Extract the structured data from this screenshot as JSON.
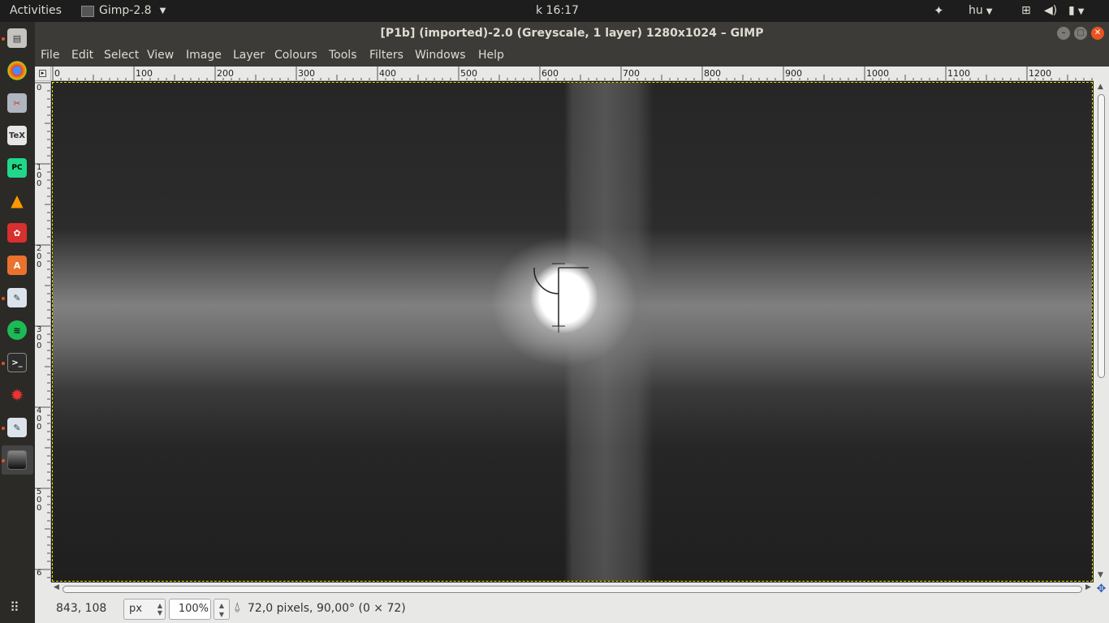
{
  "top_panel": {
    "activities": "Activities",
    "app_name": "Gimp-2.8",
    "clock": "k 16:17",
    "language": "hu"
  },
  "window": {
    "title": "[P1b] (imported)-2.0 (Greyscale, 1 layer) 1280x1024 – GIMP"
  },
  "menu": [
    "File",
    "Edit",
    "Select",
    "View",
    "Image",
    "Layer",
    "Colours",
    "Tools",
    "Filters",
    "Windows",
    "Help"
  ],
  "hruler_labels": [
    "0",
    "100",
    "200",
    "300",
    "400",
    "500",
    "600",
    "700",
    "800",
    "900",
    "1000",
    "1100",
    "1200"
  ],
  "vruler_labels": [
    "0",
    "100",
    "200",
    "300",
    "400",
    "500",
    "6"
  ],
  "status": {
    "coords": "843, 108",
    "unit": "px",
    "zoom": "100%",
    "message": "72,0 pixels, 90,00° (0 × 72)"
  },
  "launcher_icons": [
    "file-manager-icon",
    "chrome-icon",
    "settings-tool-icon",
    "texmaker-icon",
    "pycharm-icon",
    "vlc-icon",
    "wps-icon",
    "software-center-icon",
    "scanner-icon",
    "spotify-icon",
    "terminal-icon",
    "burst-icon",
    "scanner-2-icon",
    "gimp-window-icon"
  ],
  "colors": {
    "panel_bg": "#1d1d1d",
    "window_bg": "#3c3b37",
    "accent": "#e95420",
    "guide_border": "#e8e000"
  }
}
